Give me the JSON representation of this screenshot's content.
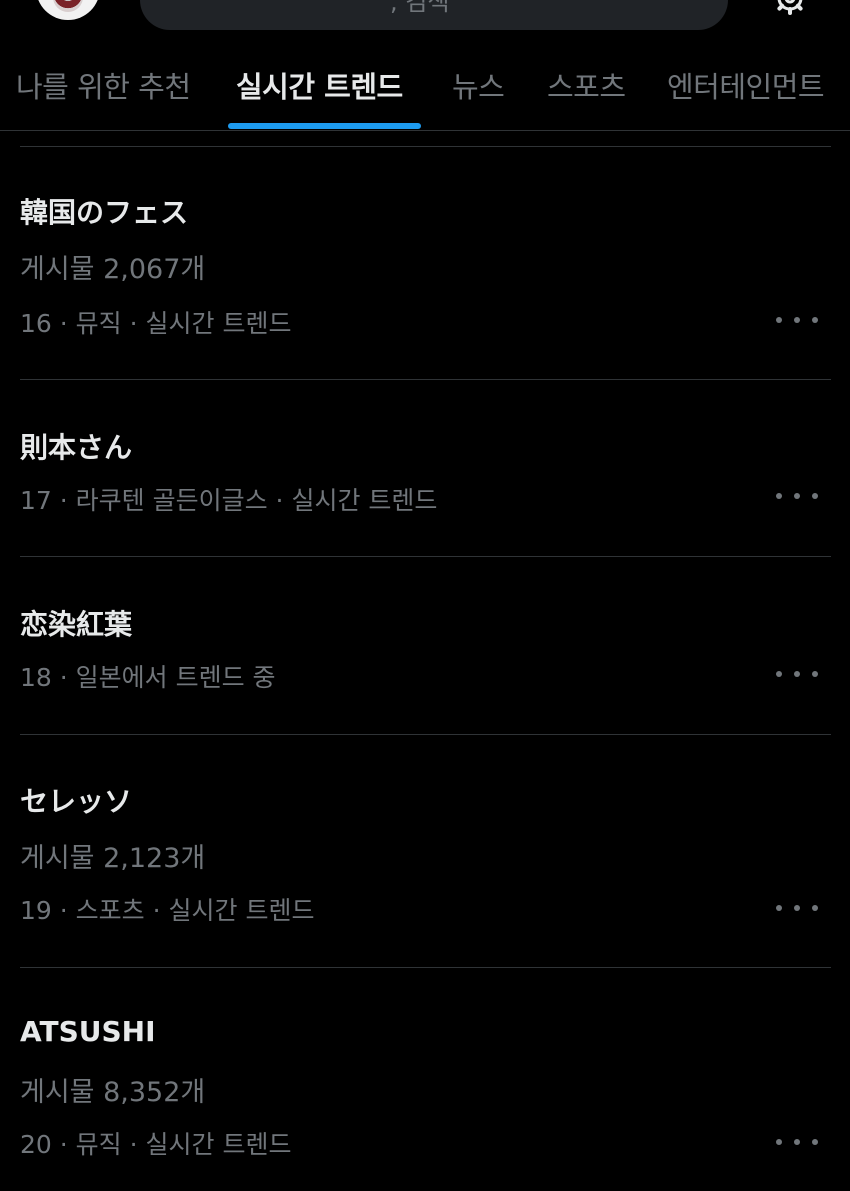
{
  "header": {
    "search_text": ", 검색"
  },
  "tabs": [
    {
      "label": "나를 위한 추천",
      "active": false
    },
    {
      "label": "실시간 트렌드",
      "active": true
    },
    {
      "label": "뉴스",
      "active": false
    },
    {
      "label": "스포츠",
      "active": false
    },
    {
      "label": "엔터테인먼트",
      "active": false
    }
  ],
  "trends": [
    {
      "title": "韓国のフェス",
      "count": "게시물 2,067개",
      "meta": "16 · 뮤직 · 실시간 트렌드"
    },
    {
      "title": "則本さん",
      "count": "",
      "meta": "17 · 라쿠텐 골든이글스 · 실시간 트렌드"
    },
    {
      "title": "恋染紅葉",
      "count": "",
      "meta": "18 · 일본에서 트렌드 중"
    },
    {
      "title": "セレッソ",
      "count": "게시물 2,123개",
      "meta": "19 · 스포츠 · 실시간 트렌드"
    },
    {
      "title": "ATSUSHI",
      "count": "게시물 8,352개",
      "meta": "20 · 뮤직 · 실시간 트렌드"
    }
  ],
  "colors": {
    "background": "#000000",
    "text_primary": "#e7e9ea",
    "text_secondary": "#71767b",
    "accent": "#1d9bf0",
    "divider": "#2f3336"
  },
  "icons": {
    "settings": "gear-icon",
    "more": "more-horizontal-icon"
  }
}
